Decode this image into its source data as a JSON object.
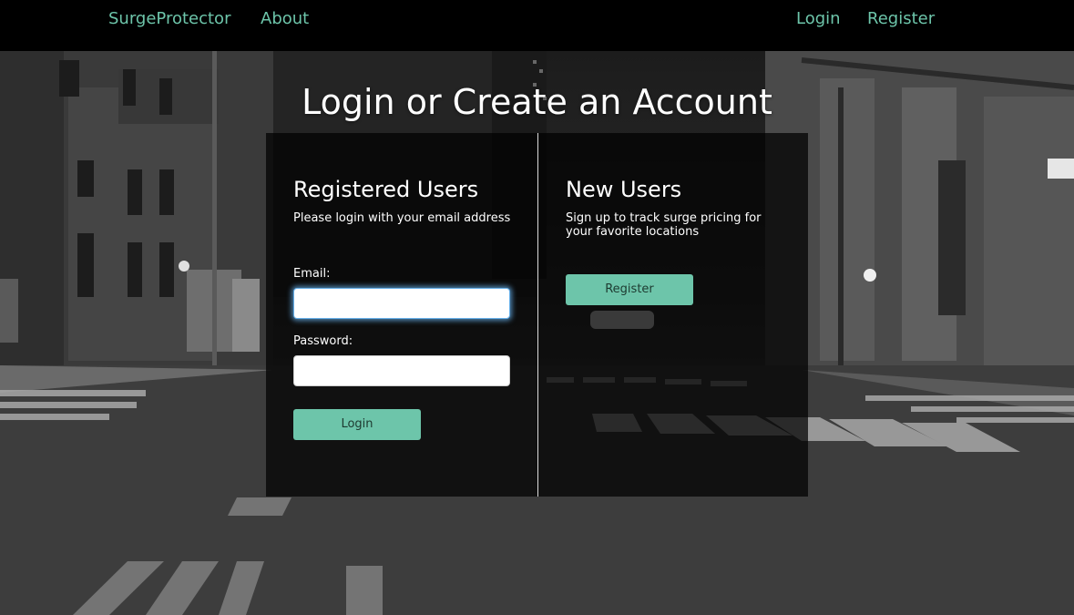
{
  "nav": {
    "brand": "SurgeProtector",
    "about": "About",
    "login": "Login",
    "register": "Register"
  },
  "page": {
    "title": "Login or Create an Account"
  },
  "registered": {
    "heading": "Registered Users",
    "subtitle": "Please login with your email address",
    "email_label": "Email:",
    "email_value": "",
    "password_label": "Password:",
    "password_value": "",
    "login_button": "Login"
  },
  "new_users": {
    "heading": "New Users",
    "subtitle": "Sign up to track surge pricing for your favorite locations",
    "register_button": "Register"
  },
  "colors": {
    "accent": "#6dc5aa",
    "navbar": "#000000",
    "panel": "rgba(0,0,0,0.72)"
  }
}
